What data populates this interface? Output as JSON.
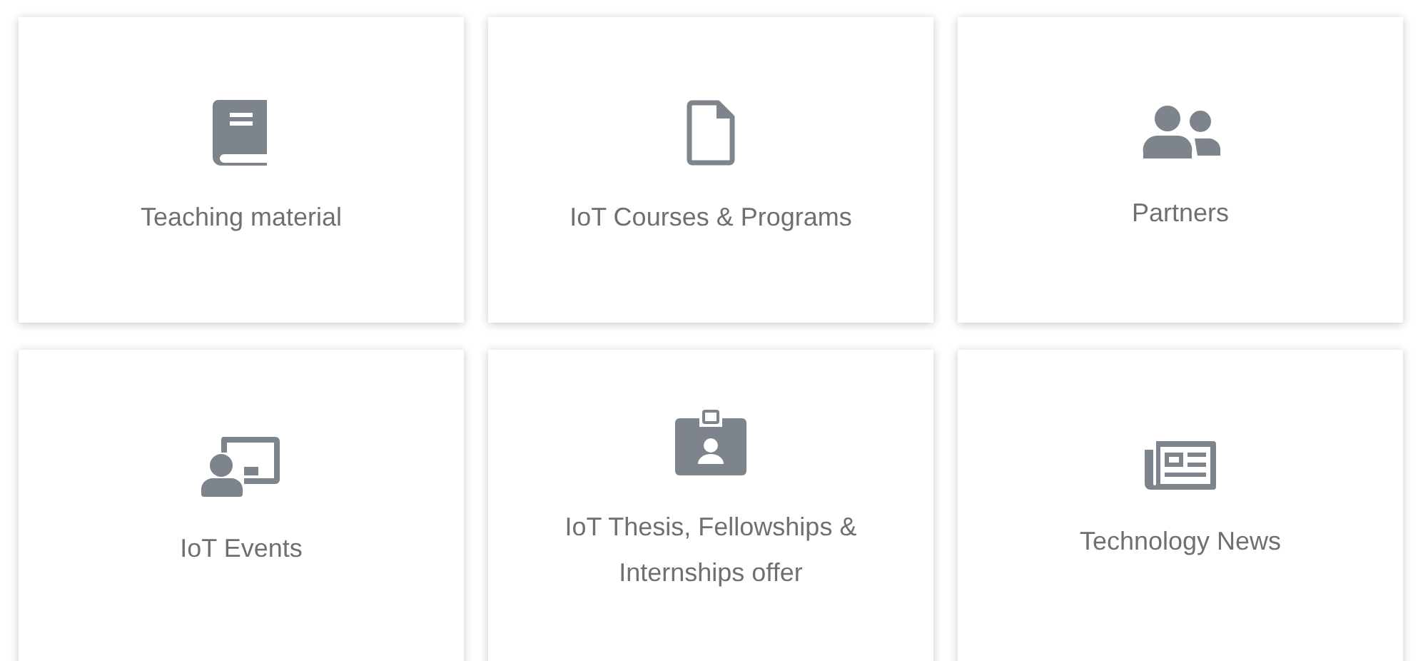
{
  "tiles": [
    {
      "label": "Teaching material"
    },
    {
      "label": "IoT Courses & Programs"
    },
    {
      "label": "Partners"
    },
    {
      "label": "IoT Events"
    },
    {
      "label": "IoT Thesis, Fellowships & Internships offer"
    },
    {
      "label": "Technology News"
    }
  ]
}
